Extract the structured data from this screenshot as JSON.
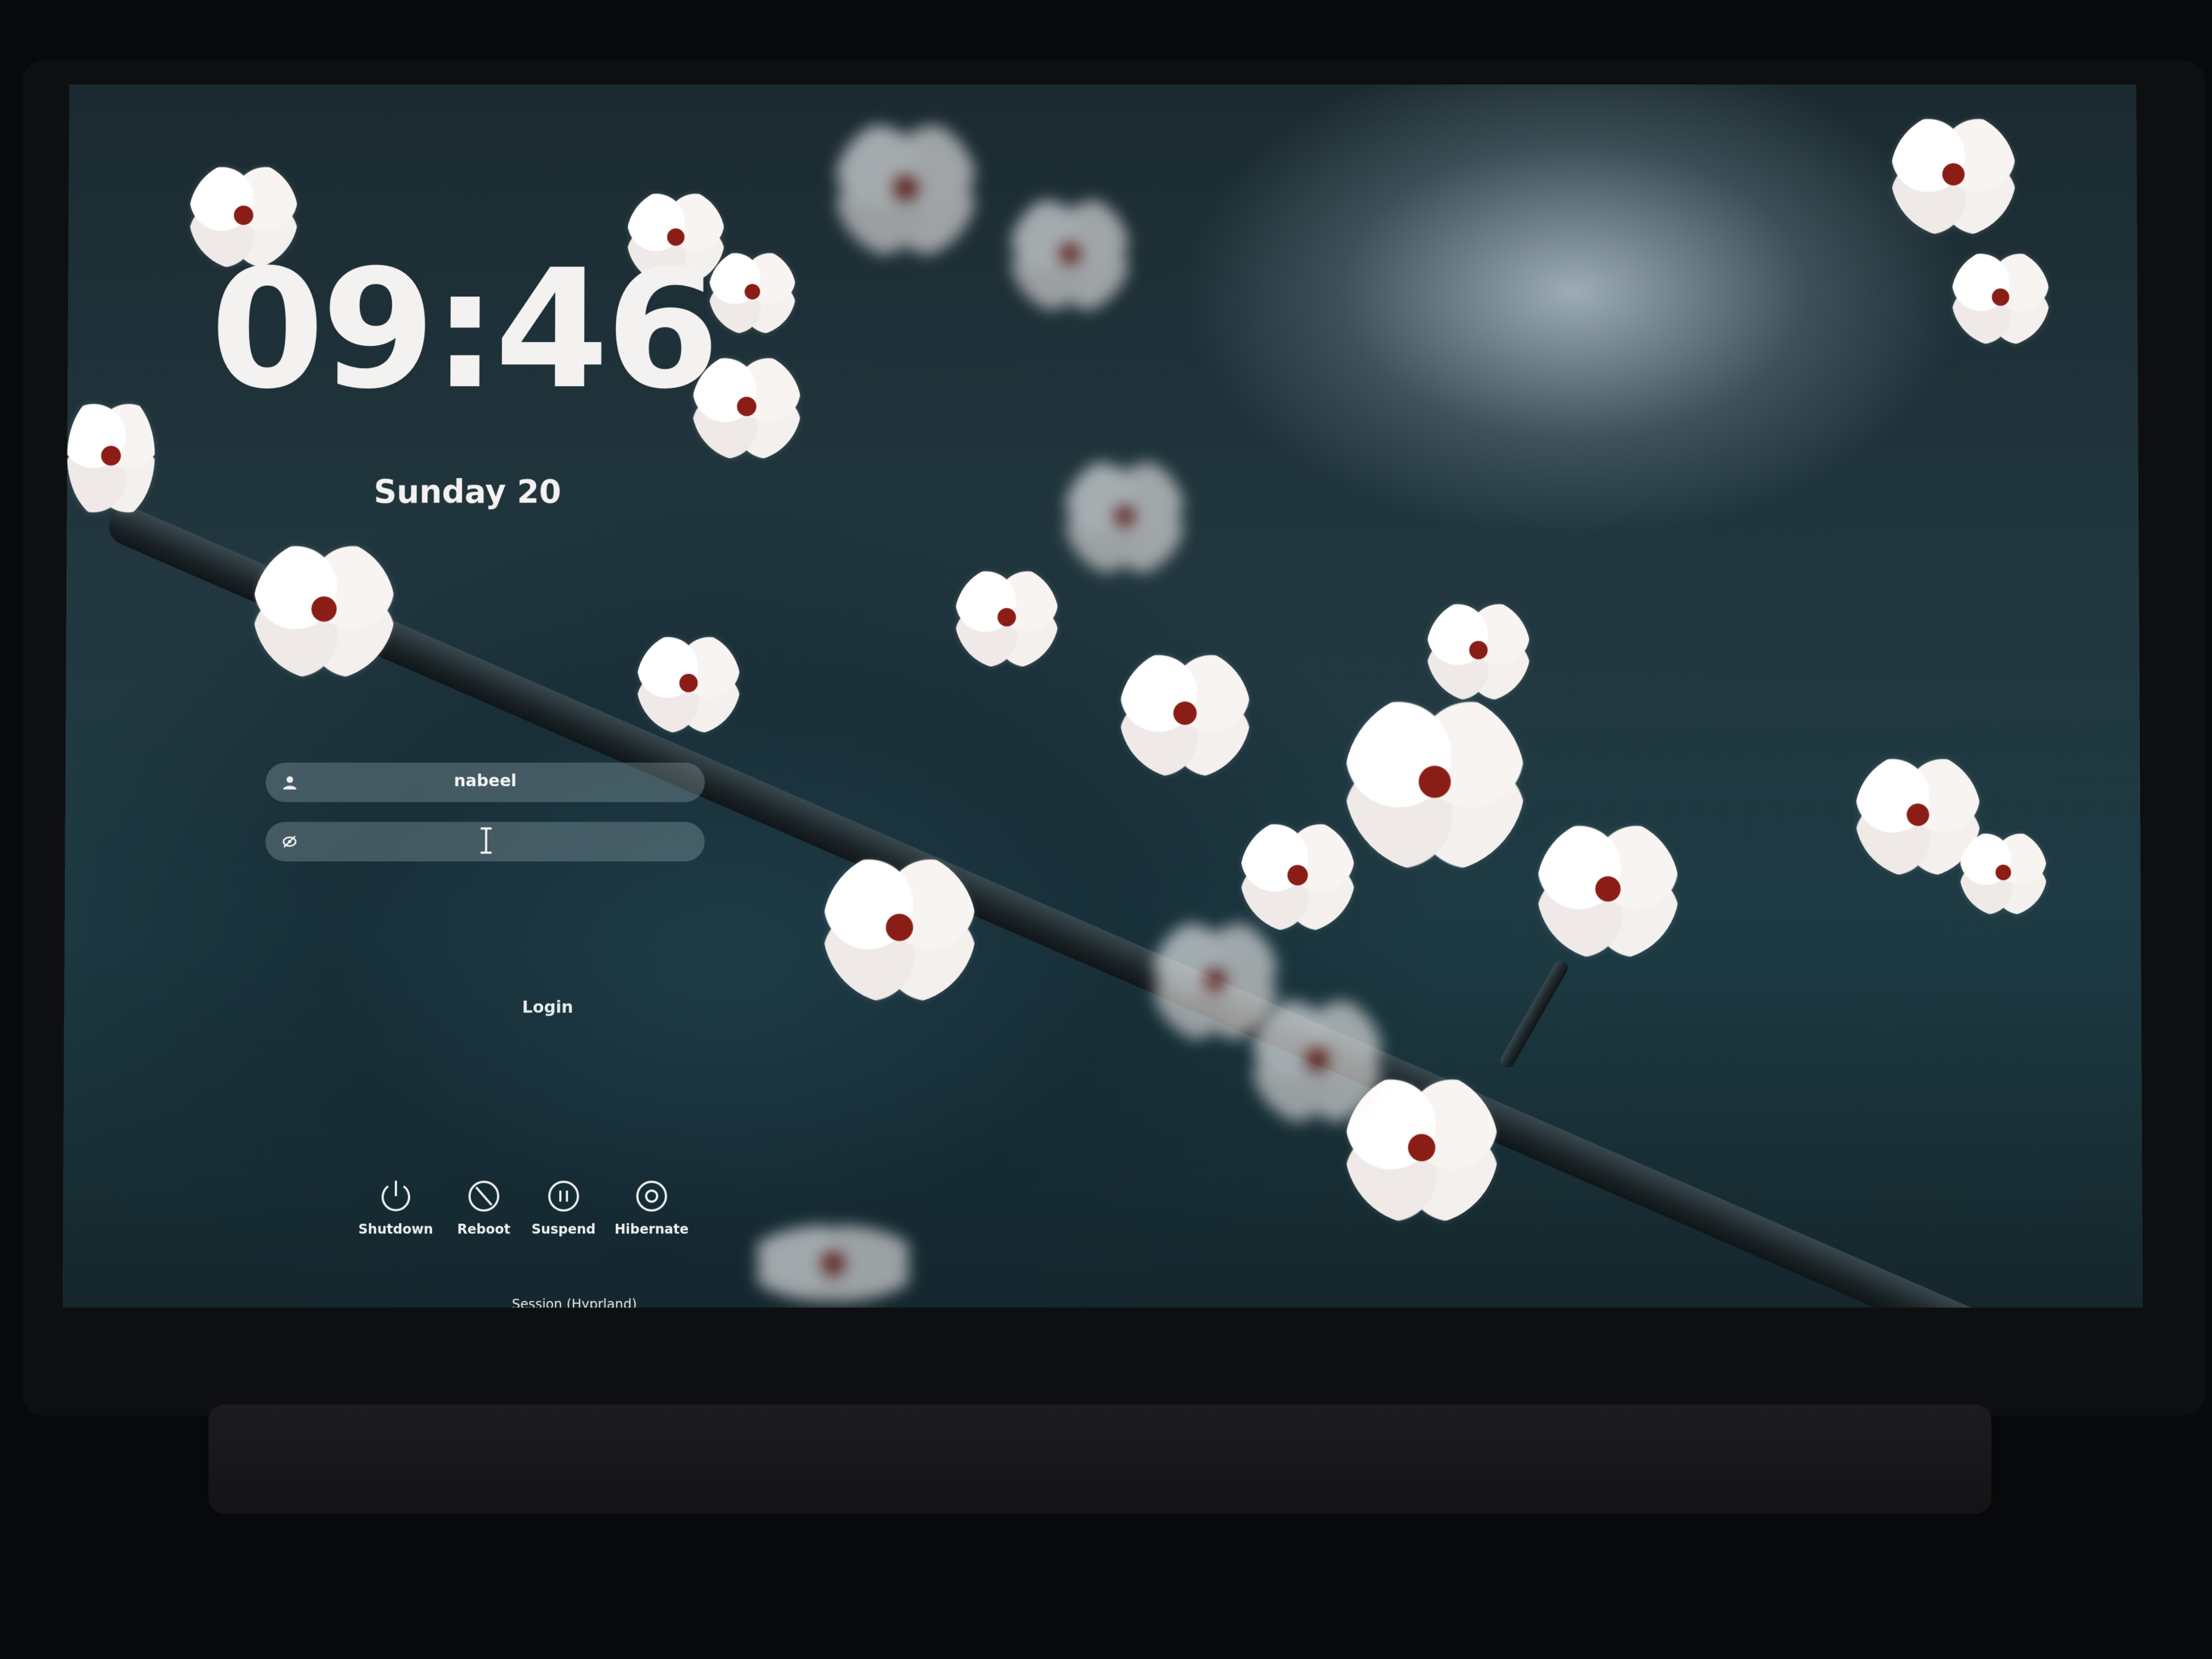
{
  "clock": {
    "time": "09:46"
  },
  "date": {
    "text": "Sunday 20"
  },
  "login": {
    "username": "nabeel",
    "user_icon": "user-icon",
    "password_icon": "eye-slash-icon",
    "login_label": "Login"
  },
  "power_actions": [
    {
      "label": "Shutdown",
      "icon": "power-icon"
    },
    {
      "label": "Reboot",
      "icon": "reboot-icon"
    },
    {
      "label": "Suspend",
      "icon": "pause-icon"
    },
    {
      "label": "Hibernate",
      "icon": "hibernate-icon"
    }
  ],
  "session": {
    "label": "Session (Hyprland)"
  },
  "colors": {
    "text": "#f4f2f0",
    "field_bg": "rgba(150,170,175,0.35)"
  }
}
